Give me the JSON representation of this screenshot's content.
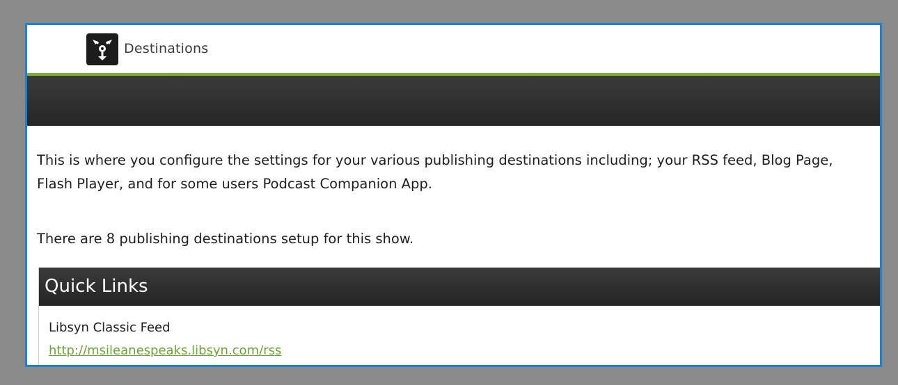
{
  "header": {
    "title": "Destinations",
    "logo_icon": "destinations-icon"
  },
  "intro": {
    "description": "This is where you configure the settings for your various publishing destinations including; your RSS feed, Blog Page, Flash Player, and for some users Podcast Companion App.",
    "count_text": "There are 8 publishing destinations setup for this show."
  },
  "quick_links": {
    "title": "Quick Links",
    "items": [
      {
        "label": "Libsyn Classic Feed",
        "url": "http://msileanespeaks.libsyn.com/rss"
      }
    ]
  },
  "colors": {
    "frame_border": "#1e7fd0",
    "accent_green": "#7bb32e",
    "dark_bar": "#2a2a2a",
    "link": "#6ea33a",
    "outer_background": "#8a8a8a"
  }
}
